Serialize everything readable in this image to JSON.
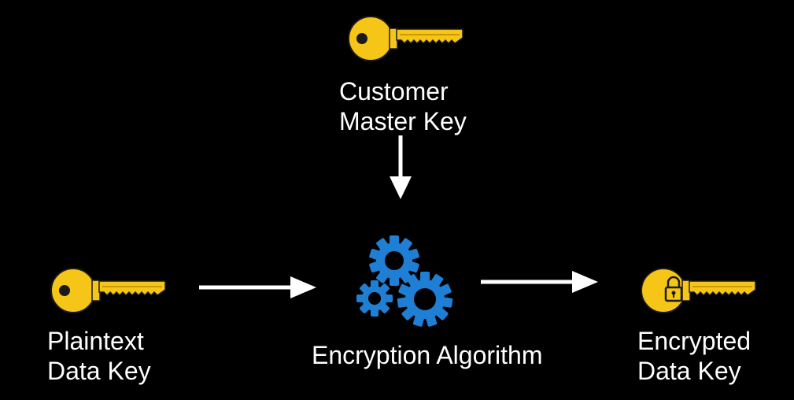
{
  "colors": {
    "background": "#000000",
    "key": "#f5c518",
    "key_outline": "#1a1a1a",
    "gear": "#1f7fd4",
    "arrow": "#ffffff",
    "text": "#ffffff"
  },
  "master_key": {
    "icon": "key-icon",
    "label_line1": "Customer",
    "label_line2": "Master Key"
  },
  "plaintext_key": {
    "icon": "key-icon",
    "label_line1": "Plaintext",
    "label_line2": "Data Key"
  },
  "algorithm": {
    "icon": "gears-icon",
    "label": "Encryption Algorithm"
  },
  "encrypted_key": {
    "icon": "locked-key-icon",
    "label_line1": "Encrypted",
    "label_line2": "Data Key"
  }
}
